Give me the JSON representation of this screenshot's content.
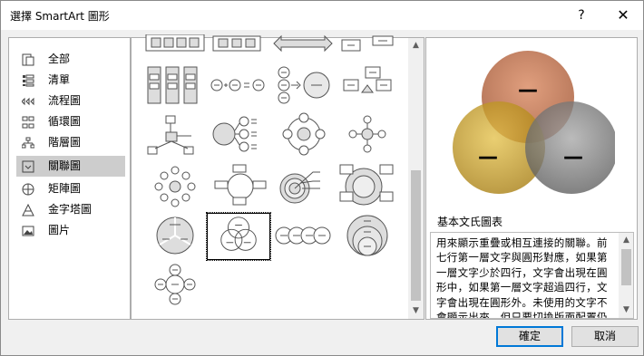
{
  "dialog": {
    "title": "選擇 SmartArt 圖形",
    "help_label": "?",
    "close_label": "✕"
  },
  "categories": [
    {
      "label": "全部",
      "icon": "all-icon",
      "selected": false
    },
    {
      "label": "清單",
      "icon": "list-icon",
      "selected": false
    },
    {
      "label": "流程圖",
      "icon": "process-icon",
      "selected": false
    },
    {
      "label": "循環圖",
      "icon": "cycle-icon",
      "selected": false
    },
    {
      "label": "階層圖",
      "icon": "hierarchy-icon",
      "selected": false
    },
    {
      "label": "關聯圖",
      "icon": "relationship-icon",
      "selected": true
    },
    {
      "label": "矩陣圖",
      "icon": "matrix-icon",
      "selected": false
    },
    {
      "label": "金字塔圖",
      "icon": "pyramid-icon",
      "selected": false
    },
    {
      "label": "圖片",
      "icon": "picture-icon",
      "selected": false
    }
  ],
  "gallery": {
    "selected_layout": "basic-venn",
    "layout_icons": [
      "funnel-icon",
      "gear-icon",
      "arrow-ribbon-icon",
      "counterbalance-icon",
      "grouped-list-icon",
      "plus-equation-icon",
      "converging-circles-icon",
      "opposing-arrows-icon",
      "radial-hub-icon",
      "radial-list-icon",
      "basic-radial-icon",
      "radial-cluster-icon",
      "diverging-radial-icon",
      "cycle-matrix-icon",
      "target-list-icon",
      "nested-target-icon",
      "basic-pie-icon",
      "basic-venn-icon",
      "linear-venn-icon",
      "stacked-venn-icon",
      "radial-venn-icon"
    ]
  },
  "preview": {
    "title": "基本文氏圖表",
    "description": "用來顯示重疊或相互連接的關聯。前\n七行第一層文字與圓形對應，如果第\n一層文字少於四行，文字會出現在圓\n形中，如果第一層文字超過四行，文\n字會出現在圓形外。未使用的文字不\n會顯示出來，但只要切換版面配置仍",
    "shape_labels": [
      "—",
      "—",
      "—"
    ],
    "colors": {
      "top": "#b5623a",
      "left": "#c9a020",
      "right": "#7a7a7a"
    }
  },
  "buttons": {
    "ok": "確定",
    "cancel": "取消"
  }
}
